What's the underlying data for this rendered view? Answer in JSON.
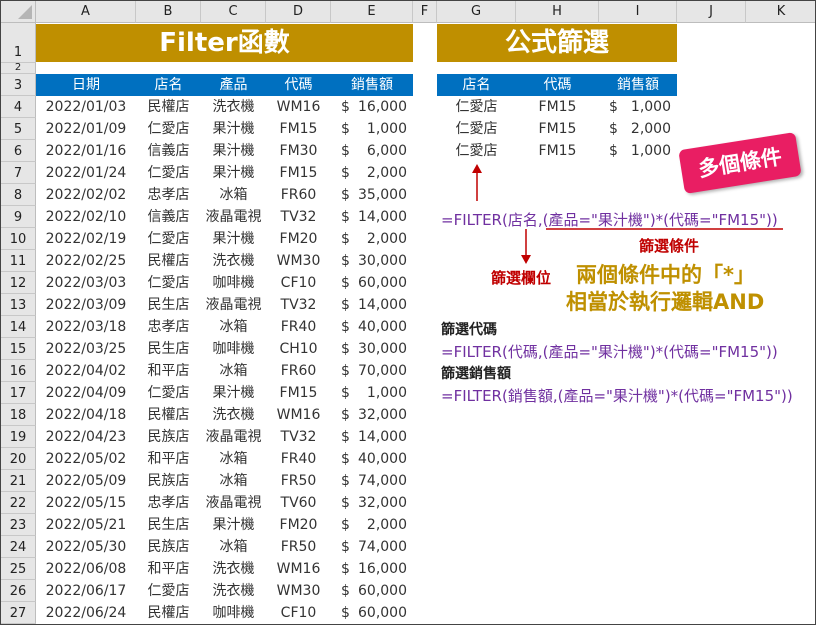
{
  "columns": [
    "A",
    "B",
    "C",
    "D",
    "E",
    "F",
    "G",
    "H",
    "I",
    "J",
    "K"
  ],
  "rows": [
    "1",
    "2",
    "3",
    "4",
    "5",
    "6",
    "7",
    "8",
    "9",
    "10",
    "11",
    "12",
    "13",
    "14",
    "15",
    "16",
    "17",
    "18",
    "19",
    "20",
    "21",
    "22",
    "23",
    "24",
    "25",
    "26",
    "27"
  ],
  "left_title": "Filter函數",
  "right_title": "公式篩選",
  "table_headers": [
    "日期",
    "店名",
    "產品",
    "代碼",
    "銷售額"
  ],
  "table_rows": [
    [
      "2022/01/03",
      "民權店",
      "洗衣機",
      "WM16",
      "16,000"
    ],
    [
      "2022/01/09",
      "仁愛店",
      "果汁機",
      "FM15",
      "1,000"
    ],
    [
      "2022/01/16",
      "信義店",
      "果汁機",
      "FM30",
      "6,000"
    ],
    [
      "2022/01/24",
      "仁愛店",
      "果汁機",
      "FM15",
      "2,000"
    ],
    [
      "2022/02/02",
      "忠孝店",
      "冰箱",
      "FR60",
      "35,000"
    ],
    [
      "2022/02/10",
      "信義店",
      "液晶電視",
      "TV32",
      "14,000"
    ],
    [
      "2022/02/19",
      "仁愛店",
      "果汁機",
      "FM20",
      "2,000"
    ],
    [
      "2022/02/25",
      "民權店",
      "洗衣機",
      "WM30",
      "30,000"
    ],
    [
      "2022/03/03",
      "仁愛店",
      "咖啡機",
      "CF10",
      "60,000"
    ],
    [
      "2022/03/09",
      "民生店",
      "液晶電視",
      "TV32",
      "14,000"
    ],
    [
      "2022/03/18",
      "忠孝店",
      "冰箱",
      "FR40",
      "40,000"
    ],
    [
      "2022/03/25",
      "民生店",
      "咖啡機",
      "CH10",
      "30,000"
    ],
    [
      "2022/04/02",
      "和平店",
      "冰箱",
      "FR60",
      "70,000"
    ],
    [
      "2022/04/09",
      "仁愛店",
      "果汁機",
      "FM15",
      "1,000"
    ],
    [
      "2022/04/18",
      "民權店",
      "洗衣機",
      "WM16",
      "32,000"
    ],
    [
      "2022/04/23",
      "民族店",
      "液晶電視",
      "TV32",
      "14,000"
    ],
    [
      "2022/05/02",
      "和平店",
      "冰箱",
      "FR40",
      "40,000"
    ],
    [
      "2022/05/09",
      "民族店",
      "冰箱",
      "FR50",
      "74,000"
    ],
    [
      "2022/05/15",
      "忠孝店",
      "液晶電視",
      "TV60",
      "32,000"
    ],
    [
      "2022/05/21",
      "民生店",
      "果汁機",
      "FM20",
      "2,000"
    ],
    [
      "2022/05/30",
      "民族店",
      "冰箱",
      "FR50",
      "74,000"
    ],
    [
      "2022/06/08",
      "和平店",
      "洗衣機",
      "WM16",
      "16,000"
    ],
    [
      "2022/06/17",
      "仁愛店",
      "洗衣機",
      "WM30",
      "60,000"
    ],
    [
      "2022/06/24",
      "民權店",
      "咖啡機",
      "CF10",
      "60,000"
    ]
  ],
  "currency": "$",
  "result_headers": [
    "店名",
    "代碼",
    "銷售額"
  ],
  "result_rows": [
    [
      "仁愛店",
      "FM15",
      "1,000"
    ],
    [
      "仁愛店",
      "FM15",
      "2,000"
    ],
    [
      "仁愛店",
      "FM15",
      "1,000"
    ]
  ],
  "badge": "多個條件",
  "formula_main": "=FILTER(店名,(產品=\"果汁機\")*(代碼=\"FM15\"))",
  "label_condition": "篩選條件",
  "label_field": "篩選欄位",
  "note_line1": "兩個條件中的「*」",
  "note_line2": "相當於執行邏輯AND",
  "label_code": "篩選代碼",
  "formula_code": "=FILTER(代碼,(產品=\"果汁機\")*(代碼=\"FM15\"))",
  "label_sales": "篩選銷售額",
  "formula_sales": "=FILTER(銷售額,(產品=\"果汁機\")*(代碼=\"FM15\"))",
  "colors": {
    "banner": "#BF8F00",
    "header": "#0070C0",
    "formula": "#7030A0",
    "annotation": "#C00000",
    "note": "#BF9000",
    "badge": "#E91E63"
  }
}
